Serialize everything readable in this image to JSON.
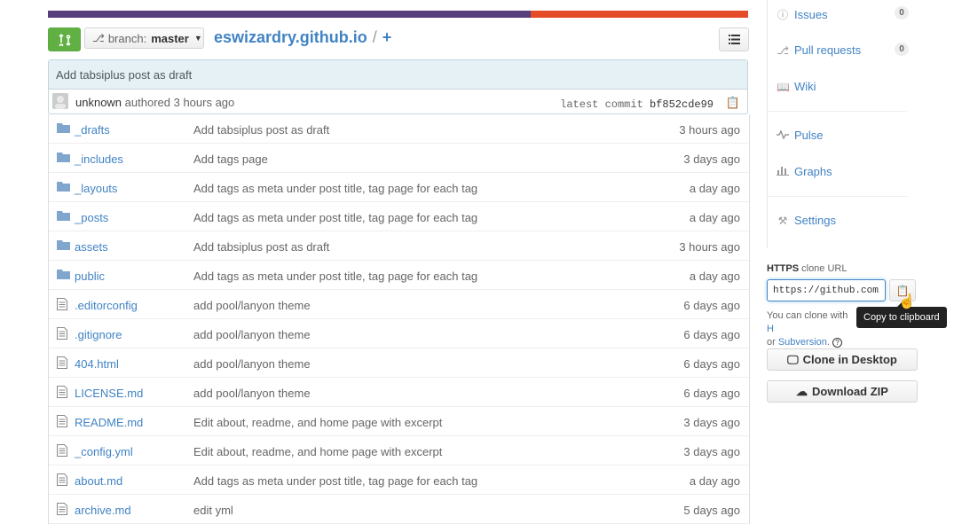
{
  "colors": {
    "lang_primary": "#563d7c",
    "lang_secondary": "#e34c26",
    "link": "#4183c4",
    "green": "#60b044"
  },
  "language_bar": [
    {
      "name": "purple",
      "percent": 69
    },
    {
      "name": "orange",
      "percent": 31
    }
  ],
  "toolbar": {
    "compare_icon": "compare-icon",
    "branch_label": "branch:",
    "branch_value": "master",
    "repo_name": "eswizardry.github.io",
    "separator": "/",
    "new_file": "+"
  },
  "commit": {
    "message": "Add tabsiplus post as draft",
    "author": "unknown",
    "authored_text": "authored 3 hours ago",
    "latest_label": "latest commit",
    "sha": "bf852cde99"
  },
  "files": [
    {
      "type": "dir",
      "name": "_drafts",
      "message": "Add tabsiplus post as draft",
      "age": "3 hours ago"
    },
    {
      "type": "dir",
      "name": "_includes",
      "message": "Add tags page",
      "age": "3 days ago"
    },
    {
      "type": "dir",
      "name": "_layouts",
      "message": "Add tags as meta under post title, tag page for each tag",
      "age": "a day ago"
    },
    {
      "type": "dir",
      "name": "_posts",
      "message": "Add tags as meta under post title, tag page for each tag",
      "age": "a day ago"
    },
    {
      "type": "dir",
      "name": "assets",
      "message": "Add tabsiplus post as draft",
      "age": "3 hours ago"
    },
    {
      "type": "dir",
      "name": "public",
      "message": "Add tags as meta under post title, tag page for each tag",
      "age": "a day ago"
    },
    {
      "type": "file",
      "name": ".editorconfig",
      "message": "add pool/lanyon theme",
      "age": "6 days ago"
    },
    {
      "type": "file",
      "name": ".gitignore",
      "message": "add pool/lanyon theme",
      "age": "6 days ago"
    },
    {
      "type": "file",
      "name": "404.html",
      "message": "add pool/lanyon theme",
      "age": "6 days ago"
    },
    {
      "type": "file",
      "name": "LICENSE.md",
      "message": "add pool/lanyon theme",
      "age": "6 days ago"
    },
    {
      "type": "file",
      "name": "README.md",
      "message": "Edit about, readme, and home page with excerpt",
      "age": "3 days ago"
    },
    {
      "type": "file",
      "name": "_config.yml",
      "message": "Edit about, readme, and home page with excerpt",
      "age": "3 days ago"
    },
    {
      "type": "file",
      "name": "about.md",
      "message": "Add tags as meta under post title, tag page for each tag",
      "age": "a day ago"
    },
    {
      "type": "file",
      "name": "archive.md",
      "message": "edit yml",
      "age": "5 days ago"
    }
  ],
  "sidebar": {
    "issues": {
      "label": "Issues",
      "count": "0",
      "icon": "issue-icon"
    },
    "pulls": {
      "label": "Pull requests",
      "count": "0",
      "icon": "pull-request-icon"
    },
    "wiki": {
      "label": "Wiki",
      "icon": "book-icon"
    },
    "pulse": {
      "label": "Pulse",
      "icon": "pulse-icon"
    },
    "graphs": {
      "label": "Graphs",
      "icon": "graph-icon"
    },
    "settings": {
      "label": "Settings",
      "icon": "tools-icon"
    }
  },
  "clone": {
    "protocol": "HTTPS",
    "heading_suffix": "clone URL",
    "url": "https://github.com/eswizardry/eswizardry.github.io.git",
    "tooltip": "Copy to clipboard",
    "help_prefix": "You can clone with",
    "help_first_link": "H",
    "help_or": "or",
    "help_svn_link": "Subversion",
    "help_suffix": ".",
    "desktop_button": "Clone in Desktop",
    "zip_button": "Download ZIP"
  }
}
